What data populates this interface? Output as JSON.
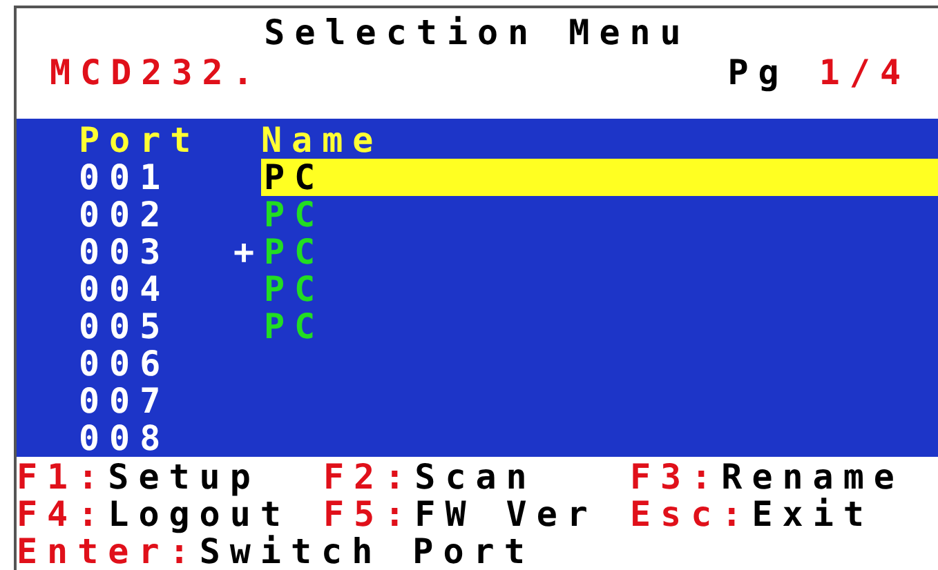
{
  "header": {
    "title": "Selection Menu",
    "model": "MCD232.",
    "page_label": "Pg",
    "page": "1/4"
  },
  "table": {
    "columns": [
      "Port",
      "Name"
    ],
    "rows": [
      {
        "port": "001",
        "name": "PC",
        "selected": true
      },
      {
        "port": "002",
        "name": "PC",
        "selected": false
      },
      {
        "port": "003",
        "marker": "+",
        "name": "PC",
        "selected": false
      },
      {
        "port": "004",
        "name": "PC",
        "selected": false
      },
      {
        "port": "005",
        "name": "PC",
        "selected": false
      },
      {
        "port": "006",
        "selected": false
      },
      {
        "port": "007",
        "selected": false
      },
      {
        "port": "008",
        "selected": false
      }
    ]
  },
  "footer": [
    [
      {
        "key": "F1:",
        "label": "Setup"
      },
      {
        "key": "F2:",
        "label": "Scan"
      },
      {
        "key": "F3:",
        "label": "Rename"
      }
    ],
    [
      {
        "key": "F4:",
        "label": "Logout"
      },
      {
        "key": "F5:",
        "label": "FW Ver"
      },
      {
        "key": "Esc:",
        "label": "Exit"
      }
    ],
    [
      {
        "key": "Enter:",
        "label": "Switch Port"
      }
    ]
  ]
}
